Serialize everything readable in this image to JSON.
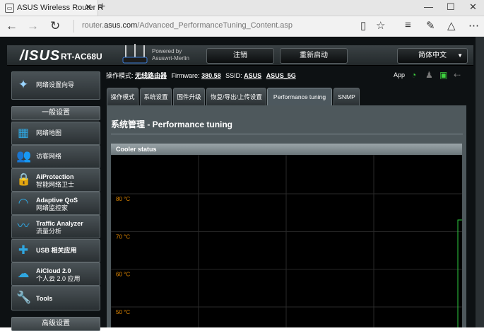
{
  "browser": {
    "tab_title": "ASUS Wireless Router R",
    "tab_close": "✕",
    "new_tab": "+",
    "url_prefix": "router.",
    "url_domain": "asus.com",
    "url_path": "/Advanced_PerformanceTuning_Content.asp",
    "minimize": "—",
    "maximize": "☐",
    "close": "✕"
  },
  "router": {
    "brand": "/ISUS",
    "model": "RT-AC68U",
    "powered_line1": "Powered by",
    "powered_line2": "Asuswrt-Merlin",
    "logout": "注销",
    "reboot": "重新启动",
    "language": "简体中文"
  },
  "status": {
    "mode_label": "操作模式:",
    "mode_value": "无线路由器",
    "firmware_label": "Firmware:",
    "firmware_value": "380.58",
    "ssid_label": "SSID:",
    "ssid_1": "ASUS",
    "ssid_2": "ASUS_5G",
    "app": "App"
  },
  "sidebar": {
    "wizard": "网络设置向导",
    "general_header": "一般设置",
    "items": [
      {
        "label1": "网络地图",
        "label2": ""
      },
      {
        "label1": "访客网络",
        "label2": ""
      },
      {
        "label1": "AiProtection",
        "label2": "智能网络卫士"
      },
      {
        "label1": "Adaptive QoS",
        "label2": "网络监控家"
      },
      {
        "label1": "Traffic Analyzer",
        "label2": "流量分析"
      },
      {
        "label1": "USB 相关应用",
        "label2": ""
      },
      {
        "label1": "AiCloud 2.0",
        "label2": "个人云 2.0 应用"
      },
      {
        "label1": "Tools",
        "label2": ""
      }
    ],
    "advanced_header": "高级设置"
  },
  "tabs": [
    "操作模式",
    "系统设置",
    "固件升级",
    "恢复/导出/上传设置",
    "Performance tuning",
    "SNMP"
  ],
  "main": {
    "page_title": "系统管理 - Performance tuning",
    "cooler_status": "Cooler status"
  },
  "chart_data": {
    "type": "line",
    "title": "",
    "xlabel": "",
    "ylabel": "",
    "y_tick_labels": [
      "80 °C",
      "70 °C",
      "60 °C",
      "50 °C"
    ],
    "y_ticks": [
      80,
      70,
      60,
      50
    ],
    "grid": true,
    "series": [],
    "colors": {
      "tick": "#e68a00",
      "grid": "#2a2a2a",
      "line": "#2ecc40"
    }
  }
}
